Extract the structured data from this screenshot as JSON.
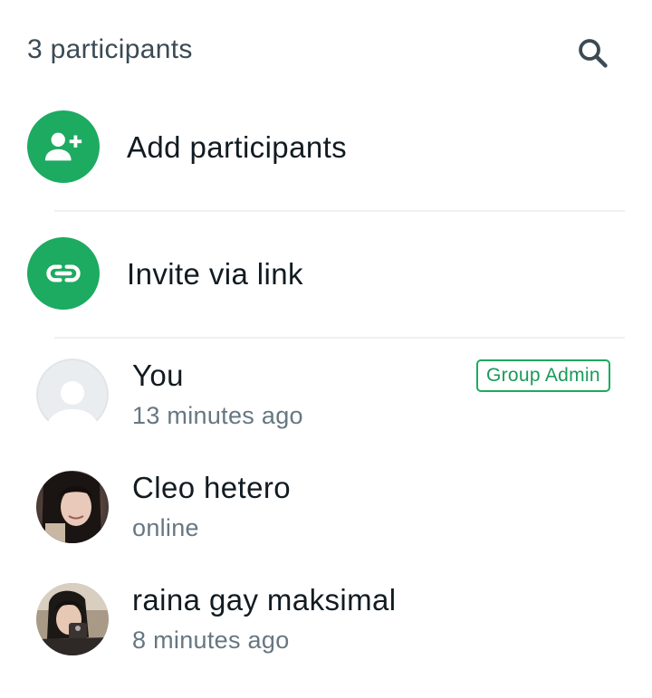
{
  "header": {
    "participants_count": "3 participants",
    "search_icon": "search-icon"
  },
  "actions": {
    "add": {
      "label": "Add participants",
      "icon": "add-person-icon"
    },
    "invite": {
      "label": "Invite via link",
      "icon": "link-icon"
    }
  },
  "colors": {
    "accent": "#1daa61",
    "primary_text": "#111b21",
    "secondary_text": "#667781",
    "divider": "#eef0f1"
  },
  "participants": [
    {
      "name": "You",
      "status": "13 minutes ago",
      "badge": "Group Admin",
      "avatar": "default-avatar-icon"
    },
    {
      "name": "Cleo hetero",
      "status": "online",
      "avatar": "profile-photo"
    },
    {
      "name": "raina gay maksimal",
      "status": "8 minutes ago",
      "avatar": "profile-photo"
    }
  ]
}
